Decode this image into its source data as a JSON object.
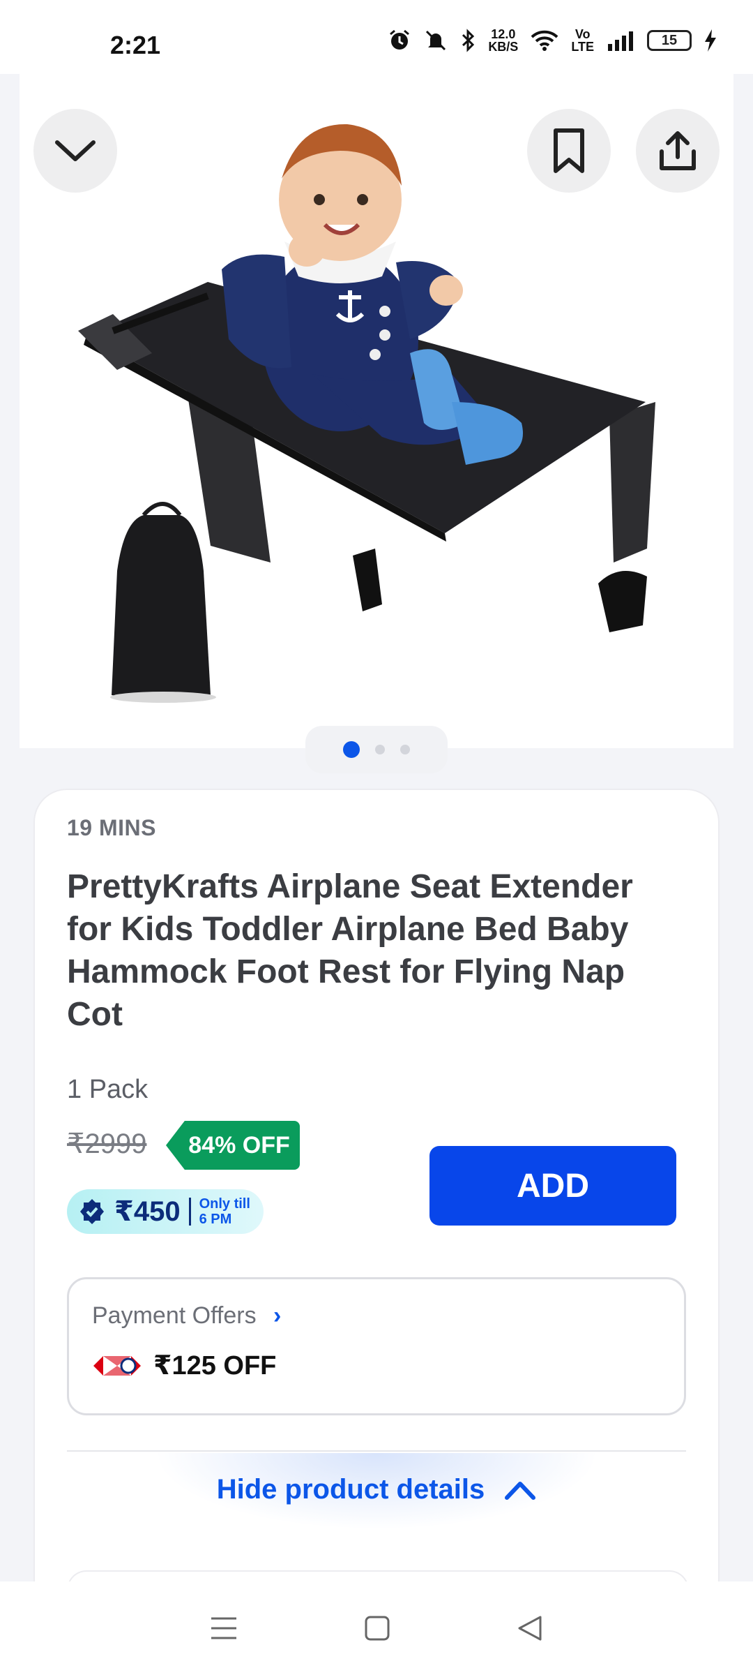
{
  "status_bar": {
    "time": "2:21",
    "net_speed_value": "12.0",
    "net_speed_unit": "KB/S",
    "volte_top": "Vo",
    "volte_bottom": "LTE",
    "battery": "15"
  },
  "product_gallery": {
    "image_count": 3,
    "active_index": 0
  },
  "product": {
    "delivery_eta": "19 MINS",
    "title": "PrettyKrafts Airplane Seat Extender for Kids Toddler Airplane Bed Baby Hammock Foot Rest for Flying Nap Cot",
    "pack_size": "1 Pack",
    "mrp": "₹2999",
    "discount_label": "84% OFF",
    "price": "₹450",
    "price_note_line1": "Only till",
    "price_note_line2": "6 PM",
    "add_label": "ADD"
  },
  "payment_offers": {
    "heading": "Payment Offers",
    "offer_value": "₹125 OFF"
  },
  "details_toggle": {
    "label": "Hide product details"
  },
  "colors": {
    "accent_blue": "#0846ea",
    "discount_green": "#0a9c5c"
  }
}
